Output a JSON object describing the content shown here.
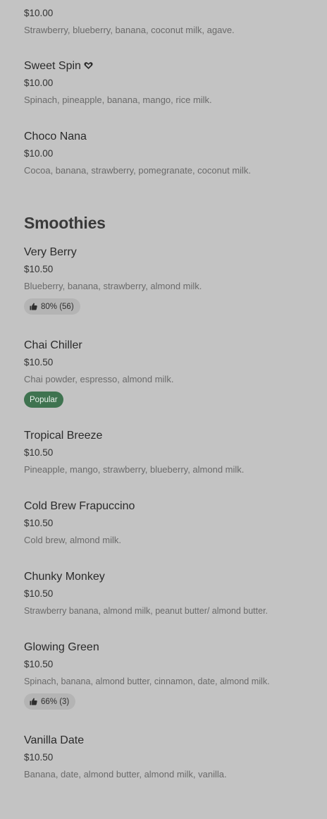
{
  "top_items": [
    {
      "name": "",
      "price": "$10.00",
      "desc": "Strawberry, blueberry, banana, coconut milk, agave."
    },
    {
      "name": "Sweet Spin",
      "price": "$10.00",
      "desc": "Spinach, pineapple, banana, mango, rice milk.",
      "icon": "heart-icon"
    },
    {
      "name": "Choco Nana",
      "price": "$10.00",
      "desc": "Cocoa, banana, strawberry, pomegranate, coconut milk."
    }
  ],
  "smoothies": {
    "title": "Smoothies",
    "items": [
      {
        "name": "Very Berry",
        "price": "$10.50",
        "desc": "Blueberry, banana, strawberry, almond milk.",
        "rating": "80% (56)",
        "rating_icon": "thumbs-up-icon"
      },
      {
        "name": "Chai Chiller",
        "price": "$10.50",
        "desc": "Chai powder, espresso, almond milk.",
        "popular": "Popular",
        "popular_color": "#3f7350"
      },
      {
        "name": "Tropical Breeze",
        "price": "$10.50",
        "desc": "Pineapple, mango, strawberry, blueberry, almond milk."
      },
      {
        "name": "Cold Brew Frapuccino",
        "price": "$10.50",
        "desc": "Cold brew, almond milk."
      },
      {
        "name": "Chunky Monkey",
        "price": "$10.50",
        "desc": "Strawberry banana, almond milk, peanut butter/ almond butter."
      },
      {
        "name": "Glowing Green",
        "price": "$10.50",
        "desc": "Spinach, banana, almond butter, cinnamon, date, almond milk.",
        "rating": "66% (3)",
        "rating_icon": "thumbs-up-icon"
      },
      {
        "name": "Vanilla Date",
        "price": "$10.50",
        "desc": "Banana, date, almond butter, almond milk, vanilla."
      }
    ]
  }
}
